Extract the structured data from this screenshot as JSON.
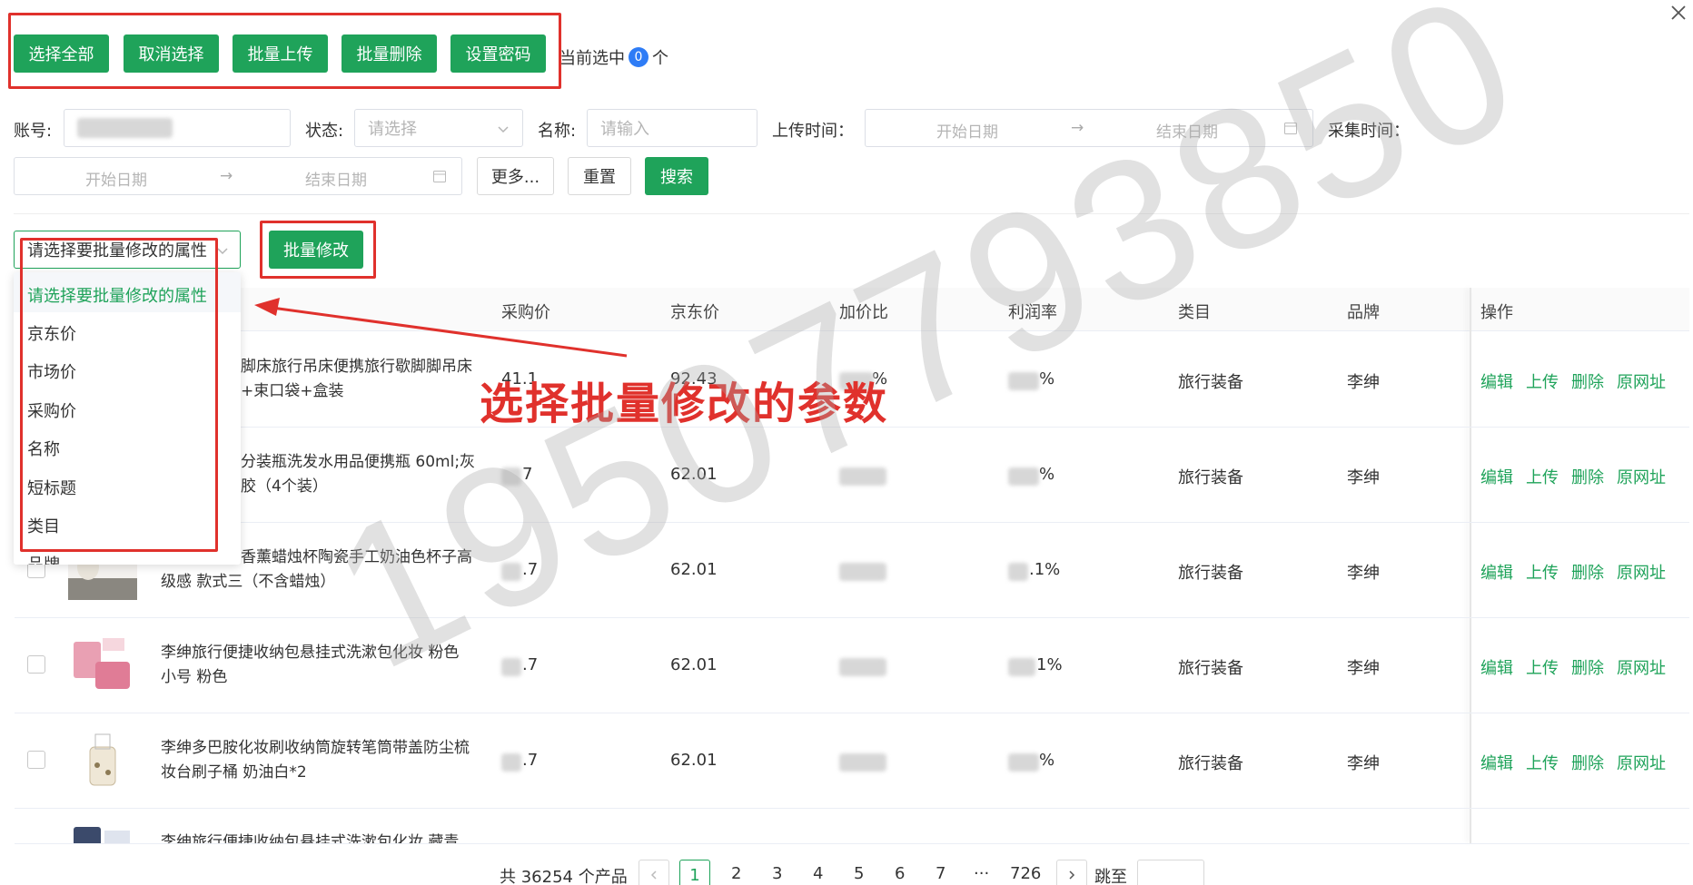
{
  "toolbar": {
    "select_all": "选择全部",
    "cancel_select": "取消选择",
    "batch_upload": "批量上传",
    "batch_delete": "批量删除",
    "set_password": "设置密码",
    "selected_prefix": "当前选中",
    "selected_count": "0",
    "selected_suffix": "个"
  },
  "filters": {
    "account_label": "账号:",
    "status_label": "状态:",
    "status_placeholder": "请选择",
    "name_label": "名称:",
    "name_placeholder": "请输入",
    "upload_time_label": "上传时间：",
    "collect_time_label": "采集时间：",
    "start_date": "开始日期",
    "end_date": "结束日期",
    "more_button": "更多...",
    "reset_button": "重置",
    "search_button": "搜索"
  },
  "batch": {
    "select_placeholder": "请选择要批量修改的属性",
    "modify_button": "批量修改",
    "options": [
      "请选择要批量修改的属性",
      "京东价",
      "市场价",
      "采购价",
      "名称",
      "短标题",
      "类目",
      "品牌"
    ]
  },
  "annotation": "选择批量修改的参数",
  "watermark": "19507793850",
  "table": {
    "headers": {
      "purchase_price": "采购价",
      "jd_price": "京东价",
      "markup": "加价比",
      "profit": "利润率",
      "category": "类目",
      "brand": "品牌",
      "actions": "操作"
    },
    "rows": [
      {
        "title1": "脚床旅行吊床便携旅行歇脚脚吊床",
        "title2": "+束口袋+盒装",
        "purchase": "41.1",
        "jd": "92.43",
        "markup": "%",
        "profit": "%",
        "category": "旅行装备",
        "brand": "李绅"
      },
      {
        "title1": "分装瓶洗发水用品便携瓶 60ml;灰",
        "title2": "胶（4个装）",
        "purchase": "7",
        "jd": "62.01",
        "markup": "",
        "profit": "%",
        "category": "旅行装备",
        "brand": "李绅"
      },
      {
        "title1": "香薰蜡烛杯陶瓷手工奶油色杯子高",
        "title2": "级感 款式三（不含蜡烛）",
        "purchase": ".7",
        "jd": "62.01",
        "markup": "",
        "profit": ".1%",
        "category": "旅行装备",
        "brand": "李绅"
      },
      {
        "title1": "李绅旅行便捷收纳包悬挂式洗漱包化妆 粉色",
        "title2": "小号 粉色",
        "purchase": ".7",
        "jd": "62.01",
        "markup": "",
        "profit": "1%",
        "category": "旅行装备",
        "brand": "李绅"
      },
      {
        "title1": "李绅多巴胺化妆刷收纳筒旋转笔筒带盖防尘梳",
        "title2": "妆台刷子桶 奶油白*2",
        "purchase": ".7",
        "jd": "62.01",
        "markup": "",
        "profit": "%",
        "category": "旅行装备",
        "brand": "李绅"
      },
      {
        "title1": "李绅旅行便捷收纳包悬挂式洗漱包化妆 藏青",
        "title2": "",
        "purchase": "",
        "jd": "",
        "markup": "",
        "profit": "",
        "category": "",
        "brand": ""
      }
    ],
    "actions": {
      "edit": "编辑",
      "upload": "上传",
      "delete": "删除",
      "source": "原网址"
    }
  },
  "pagination": {
    "total": "共 36254 个产品",
    "pages": [
      "1",
      "2",
      "3",
      "4",
      "5",
      "6",
      "7"
    ],
    "ellipsis": "···",
    "last_page": "726",
    "goto_label": "跳至",
    "prev_icon": "chevron-left-icon",
    "next_icon": "chevron-right-icon"
  },
  "colors": {
    "primary": "#1fa35a",
    "annotation": "#e0312c"
  }
}
